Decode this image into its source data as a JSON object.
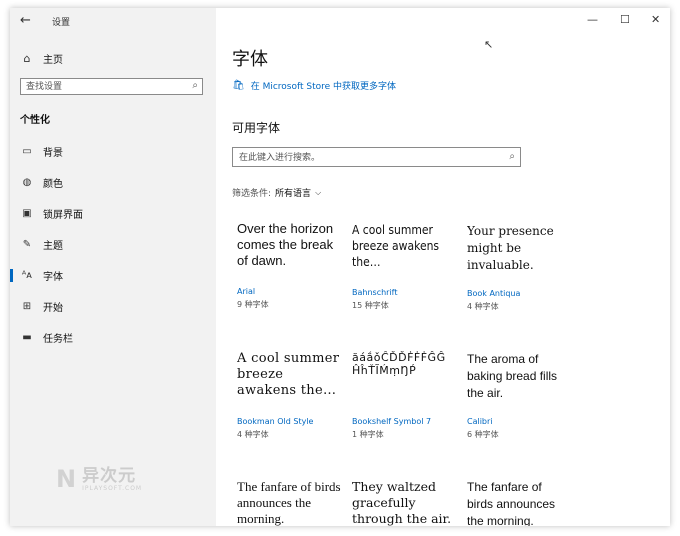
{
  "sidebar": {
    "app_title": "设置",
    "home_label": "主页",
    "search_placeholder": "查找设置",
    "section_title": "个性化",
    "items": [
      {
        "label": "背景",
        "icon": "image-icon"
      },
      {
        "label": "颜色",
        "icon": "palette-icon"
      },
      {
        "label": "锁屏界面",
        "icon": "lock-screen-icon"
      },
      {
        "label": "主题",
        "icon": "theme-icon"
      },
      {
        "label": "字体",
        "icon": "font-icon"
      },
      {
        "label": "开始",
        "icon": "start-icon"
      },
      {
        "label": "任务栏",
        "icon": "taskbar-icon"
      }
    ],
    "active_item": "字体"
  },
  "watermark": {
    "logo": "N",
    "main": "异次元",
    "sub": "IPLAYSOFT.COM"
  },
  "main": {
    "title": "字体",
    "store_link": "在 Microsoft Store 中获取更多字体",
    "available_heading": "可用字体",
    "search_placeholder": "在此键入进行搜索。",
    "filter_label": "筛选条件:",
    "filter_value": "所有语言",
    "fonts": [
      {
        "preview": "Over the horizon comes the break of dawn.",
        "name": "Arial",
        "count": "9 种字体"
      },
      {
        "preview": "A cool summer breeze awakens the…",
        "name": "Bahnschrift",
        "count": "15 种字体"
      },
      {
        "preview": "Your presence might be invaluable.",
        "name": "Book Antiqua",
        "count": "4 种字体"
      },
      {
        "preview": "A cool summer breeze awakens the…",
        "name": "Bookman Old Style",
        "count": "4 种字体"
      },
      {
        "preview": "ăáắǒĈĎĎḞḞḞĜĜ ĤĥŤĨḾṃŊṔ",
        "name": "Bookshelf Symbol 7",
        "count": "1 种字体"
      },
      {
        "preview": "The aroma of baking bread fills the air.",
        "name": "Calibri",
        "count": "6 种字体"
      },
      {
        "preview": "The fanfare of birds announces the morning.",
        "name": "",
        "count": ""
      },
      {
        "preview": "They waltzed gracefully through the air.",
        "name": "",
        "count": ""
      },
      {
        "preview": "The fanfare of birds announces the morning.",
        "name": "",
        "count": ""
      }
    ]
  },
  "window_controls": {
    "minimize": "—",
    "maximize": "☐",
    "close": "✕"
  },
  "colors": {
    "accent": "#0067c0",
    "sidebar_bg": "#f2f2f2"
  }
}
